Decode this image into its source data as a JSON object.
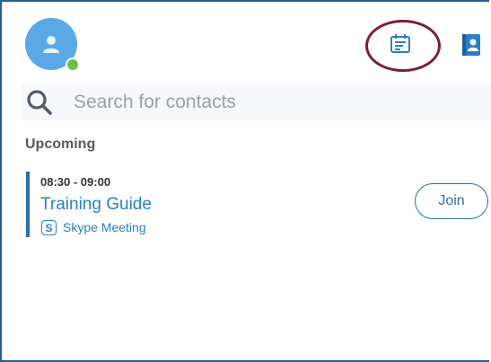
{
  "search": {
    "placeholder": "Search for contacts"
  },
  "upcoming": {
    "title": "Upcoming",
    "meetings": [
      {
        "time": "08:30 - 09:00",
        "title": "Training Guide",
        "type_icon_letter": "S",
        "type": "Skype Meeting",
        "join_label": "Join"
      }
    ]
  },
  "colors": {
    "accent": "#2d7fc1",
    "avatar": "#5aa9e6",
    "presence": "#6cc04a",
    "highlight_ring": "#7a1f33"
  },
  "icons": {
    "avatar": "user-silhouette-icon",
    "calendar": "calendar-icon",
    "contacts": "contact-book-icon",
    "search": "search-icon",
    "meeting_type": "skype-icon"
  }
}
